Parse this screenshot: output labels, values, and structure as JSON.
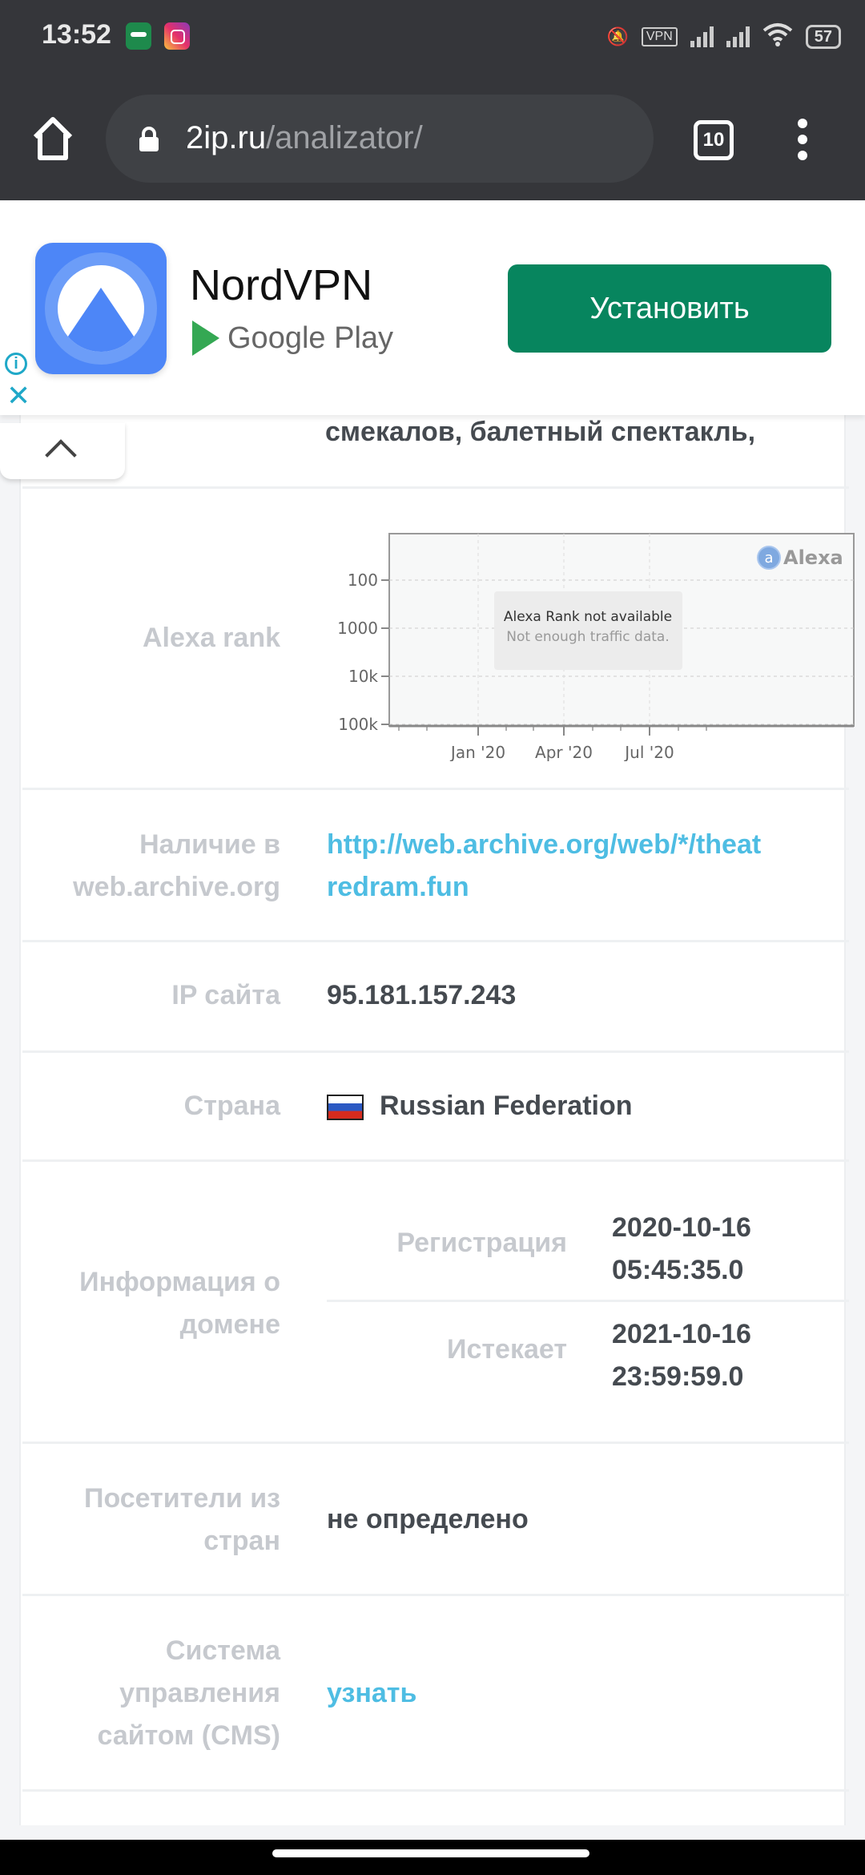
{
  "status_bar": {
    "time": "13:52",
    "notification_icons": [
      "vpn-key-app-icon",
      "instagram-icon"
    ],
    "system_icons": [
      "mute-icon",
      "vpn-icon",
      "signal-icon",
      "signal-icon",
      "wifi-icon",
      "battery-icon"
    ],
    "vpn_label": "VPN",
    "battery": "57"
  },
  "browser": {
    "url_domain": "2ip.ru",
    "url_path": "/analizator/",
    "tab_count": "10"
  },
  "ad": {
    "app_name": "NordVPN",
    "store": "Google Play",
    "install_label": "Установить",
    "accent": "#07855e"
  },
  "page": {
    "overflow_text": "смекалов, балетный спектакль,",
    "rows": [
      {
        "label": "Alexa rank"
      },
      {
        "label": "Наличие в web.archive.org",
        "value": "http://web.archive.org/web/*/theatredram.fun",
        "value_line1": "http://web.archive.org/web/*/theat",
        "value_line2": "redram.fun"
      },
      {
        "label": "IP сайта",
        "value": "95.181.157.243"
      },
      {
        "label": "Страна",
        "value": "Russian Federation"
      },
      {
        "label_line1": "Информация о",
        "label_line2": "домене",
        "sub": [
          {
            "label": "Регистрация",
            "value_line1": "2020-10-16",
            "value_line2": "05:45:35.0"
          },
          {
            "label": "Истекает",
            "value_line1": "2021-10-16",
            "value_line2": "23:59:59.0"
          }
        ]
      },
      {
        "label_line1": "Посетители из",
        "label_line2": "стран",
        "value": "не определено"
      },
      {
        "label_line1": "Система",
        "label_line2": "управления",
        "label_line3": "сайтом  (CMS)",
        "value": "узнать"
      }
    ],
    "label_line1_web": "Наличие в",
    "label_line2_web": "web.archive.org"
  },
  "chart_data": {
    "type": "line",
    "title": "",
    "brand": "Alexa",
    "message_title": "Alexa Rank not available",
    "message_sub": "Not enough traffic data.",
    "y_ticks": [
      "100",
      "1000",
      "10k",
      "100k"
    ],
    "x_ticks": [
      "Jan '20",
      "Apr '20",
      "Jul '20"
    ],
    "series": [],
    "yscale": "log-inverted",
    "grid": true
  }
}
